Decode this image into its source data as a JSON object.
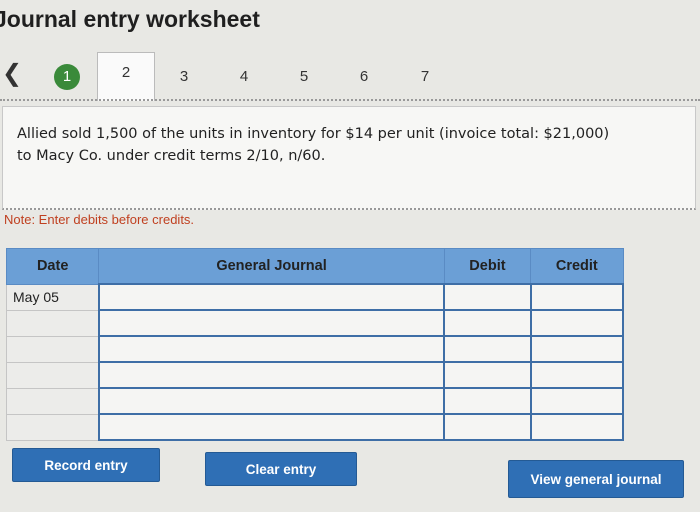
{
  "worksheet": {
    "title": "Journal entry worksheet",
    "note": "Note: Enter debits before credits.",
    "description": "Allied sold 1,500 of the units in inventory for $14 per unit (invoice total: $21,000) to Macy Co. under credit terms 2/10, n/60."
  },
  "stepper": {
    "prev_icon": "chevron-left-icon",
    "steps": [
      "1",
      "2",
      "3",
      "4",
      "5",
      "6",
      "7"
    ],
    "completed_step": "1",
    "active_step": "2"
  },
  "journal": {
    "headers": {
      "date": "Date",
      "general_journal": "General Journal",
      "debit": "Debit",
      "credit": "Credit"
    },
    "rows": [
      {
        "date": "May 05",
        "account": "",
        "debit": "",
        "credit": ""
      },
      {
        "date": "",
        "account": "",
        "debit": "",
        "credit": ""
      },
      {
        "date": "",
        "account": "",
        "debit": "",
        "credit": ""
      },
      {
        "date": "",
        "account": "",
        "debit": "",
        "credit": ""
      },
      {
        "date": "",
        "account": "",
        "debit": "",
        "credit": ""
      },
      {
        "date": "",
        "account": "",
        "debit": "",
        "credit": ""
      }
    ]
  },
  "buttons": {
    "record": "Record entry",
    "clear": "Clear entry",
    "view": "View general journal"
  },
  "colors": {
    "header_blue": "#6b9fd6",
    "button_blue": "#2f6fb5",
    "completed_green": "#3a8a3a",
    "note_red": "#c04020"
  }
}
